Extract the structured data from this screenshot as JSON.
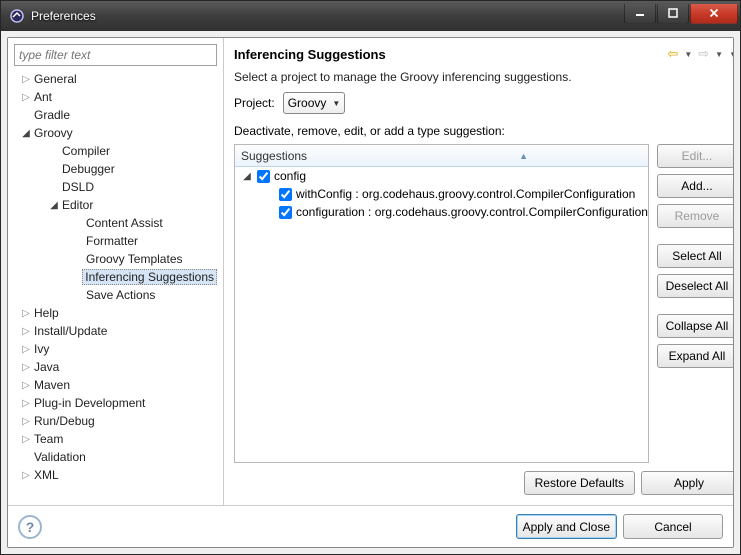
{
  "window": {
    "title": "Preferences"
  },
  "filter": {
    "placeholder": "type filter text"
  },
  "tree": [
    {
      "label": "General",
      "depth": 0,
      "expandable": true,
      "expanded": false
    },
    {
      "label": "Ant",
      "depth": 0,
      "expandable": true,
      "expanded": false
    },
    {
      "label": "Gradle",
      "depth": 0,
      "expandable": false
    },
    {
      "label": "Groovy",
      "depth": 0,
      "expandable": true,
      "expanded": true
    },
    {
      "label": "Compiler",
      "depth": 1,
      "expandable": false
    },
    {
      "label": "Debugger",
      "depth": 1,
      "expandable": false
    },
    {
      "label": "DSLD",
      "depth": 1,
      "expandable": false
    },
    {
      "label": "Editor",
      "depth": 1,
      "expandable": true,
      "expanded": true
    },
    {
      "label": "Content Assist",
      "depth": 2,
      "expandable": false
    },
    {
      "label": "Formatter",
      "depth": 2,
      "expandable": false
    },
    {
      "label": "Groovy Templates",
      "depth": 2,
      "expandable": false
    },
    {
      "label": "Inferencing Suggestions",
      "depth": 2,
      "expandable": false,
      "selected": true
    },
    {
      "label": "Save Actions",
      "depth": 2,
      "expandable": false
    },
    {
      "label": "Help",
      "depth": 0,
      "expandable": true,
      "expanded": false
    },
    {
      "label": "Install/Update",
      "depth": 0,
      "expandable": true,
      "expanded": false
    },
    {
      "label": "Ivy",
      "depth": 0,
      "expandable": true,
      "expanded": false
    },
    {
      "label": "Java",
      "depth": 0,
      "expandable": true,
      "expanded": false
    },
    {
      "label": "Maven",
      "depth": 0,
      "expandable": true,
      "expanded": false
    },
    {
      "label": "Plug-in Development",
      "depth": 0,
      "expandable": true,
      "expanded": false
    },
    {
      "label": "Run/Debug",
      "depth": 0,
      "expandable": true,
      "expanded": false
    },
    {
      "label": "Team",
      "depth": 0,
      "expandable": true,
      "expanded": false
    },
    {
      "label": "Validation",
      "depth": 0,
      "expandable": false
    },
    {
      "label": "XML",
      "depth": 0,
      "expandable": true,
      "expanded": false
    }
  ],
  "page": {
    "title": "Inferencing Suggestions",
    "desc": "Select a project to manage the Groovy inferencing suggestions.",
    "project_label": "Project:",
    "project_value": "Groovy",
    "deactivate_label": "Deactivate, remove, edit, or add a type suggestion:",
    "table_header": "Suggestions",
    "rows": [
      {
        "kind": "group",
        "label": "config",
        "checked": true
      },
      {
        "kind": "item",
        "label": "withConfig : org.codehaus.groovy.control.CompilerConfiguration",
        "checked": true
      },
      {
        "kind": "item",
        "label": "configuration : org.codehaus.groovy.control.CompilerConfiguration",
        "checked": true
      }
    ]
  },
  "buttons": {
    "edit": "Edit...",
    "add": "Add...",
    "remove": "Remove",
    "select_all": "Select All",
    "deselect_all": "Deselect All",
    "collapse_all": "Collapse All",
    "expand_all": "Expand All",
    "restore_defaults": "Restore Defaults",
    "apply": "Apply",
    "apply_close": "Apply and Close",
    "cancel": "Cancel"
  }
}
